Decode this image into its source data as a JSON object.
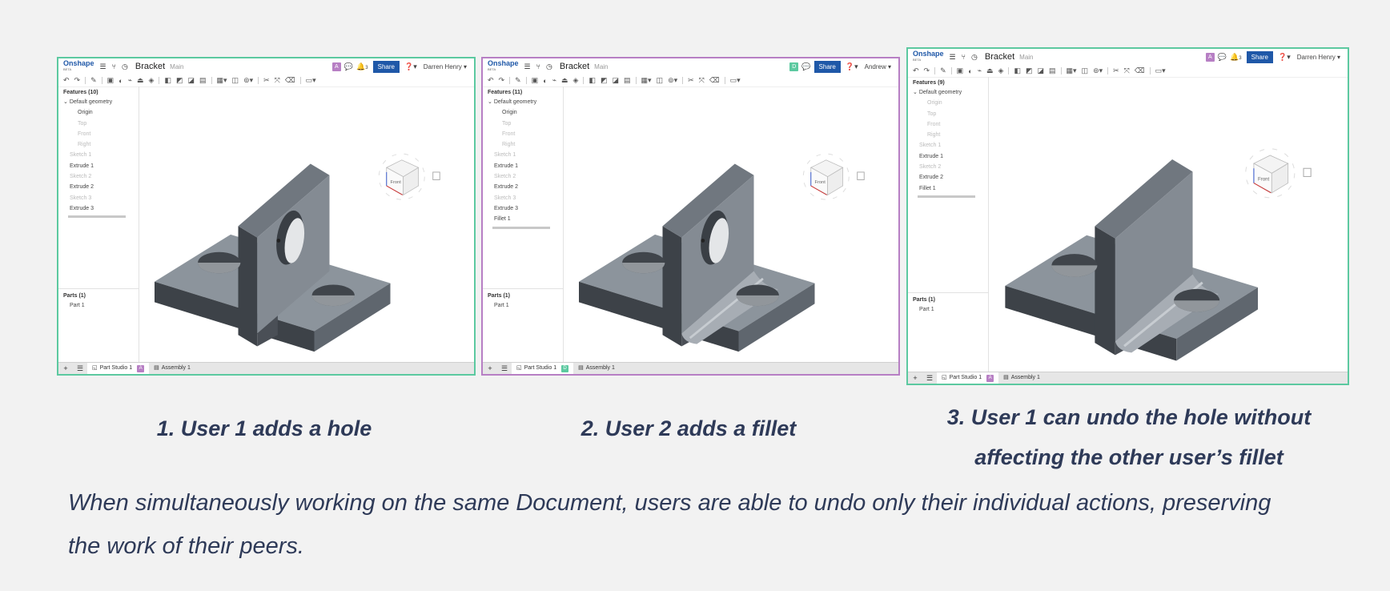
{
  "colors": {
    "teal_border": "#5cc9a0",
    "purple_border": "#b77fc4",
    "brand_blue": "#1f58a8",
    "text": "#2e3a58",
    "badge_purple": "#b77fc4",
    "badge_green": "#5cc9a0"
  },
  "common": {
    "logo": "Onshape",
    "logo_sub": "BETA",
    "doc_title": "Bracket",
    "branch": "Main",
    "share": "Share",
    "features_label": "Default geometry",
    "parts_title": "Parts (1)",
    "part_item": "Part 1",
    "tab_part_studio": "Part Studio 1",
    "tab_assembly": "Assembly 1"
  },
  "panels": [
    {
      "badge": "A",
      "user": "Darren Henry",
      "features_title": "Features (10)",
      "notif_count": "3",
      "items": [
        {
          "label": "Origin",
          "style": "ind"
        },
        {
          "label": "Top",
          "style": "ind dim"
        },
        {
          "label": "Front",
          "style": "ind dim"
        },
        {
          "label": "Right",
          "style": "ind dim"
        },
        {
          "label": "Sketch 1",
          "style": "mid dim"
        },
        {
          "label": "Extrude 1",
          "style": "mid"
        },
        {
          "label": "Sketch 2",
          "style": "mid dim"
        },
        {
          "label": "Extrude 2",
          "style": "mid"
        },
        {
          "label": "Sketch 3",
          "style": "mid dim"
        },
        {
          "label": "Extrude 3",
          "style": "mid"
        }
      ],
      "hole": true,
      "fillet": false
    },
    {
      "badge": "D",
      "user": "Andrew",
      "features_title": "Features (11)",
      "items": [
        {
          "label": "Origin",
          "style": "ind"
        },
        {
          "label": "Top",
          "style": "ind dim"
        },
        {
          "label": "Front",
          "style": "ind dim"
        },
        {
          "label": "Right",
          "style": "ind dim"
        },
        {
          "label": "Sketch 1",
          "style": "mid dim"
        },
        {
          "label": "Extrude 1",
          "style": "mid"
        },
        {
          "label": "Sketch 2",
          "style": "mid dim"
        },
        {
          "label": "Extrude 2",
          "style": "mid"
        },
        {
          "label": "Sketch 3",
          "style": "mid dim"
        },
        {
          "label": "Extrude 3",
          "style": "mid"
        },
        {
          "label": "Fillet 1",
          "style": "mid"
        }
      ],
      "hole": true,
      "fillet": true
    },
    {
      "badge": "A",
      "user": "Darren Henry",
      "features_title": "Features (9)",
      "notif_count": "3",
      "items": [
        {
          "label": "Origin",
          "style": "ind dim"
        },
        {
          "label": "Top",
          "style": "ind dim"
        },
        {
          "label": "Front",
          "style": "ind dim"
        },
        {
          "label": "Right",
          "style": "ind dim"
        },
        {
          "label": "Sketch 1",
          "style": "mid dim"
        },
        {
          "label": "Extrude 1",
          "style": "mid"
        },
        {
          "label": "Sketch 2",
          "style": "mid dim"
        },
        {
          "label": "Extrude 2",
          "style": "mid"
        },
        {
          "label": "Fillet 1",
          "style": "mid"
        }
      ],
      "hole": false,
      "fillet": true
    }
  ],
  "captions": {
    "step1": "1.  User 1 adds a hole",
    "step2": "2.  User 2 adds a fillet",
    "step3_line1": "3.  User 1 can undo the hole without",
    "step3_line2": "affecting the other user’s fillet"
  },
  "footer": {
    "line1": "When simultaneously working on the same Document, users are able to undo only their individual actions, preserving",
    "line2": "the work of their peers."
  },
  "icons": [
    "undo-icon",
    "redo-icon",
    "sketch-icon",
    "menu-icon",
    "branch-icon",
    "history-icon",
    "chat-icon",
    "bell-icon",
    "help-icon",
    "view-cube-icon",
    "add-tab-icon",
    "tab-list-icon"
  ]
}
